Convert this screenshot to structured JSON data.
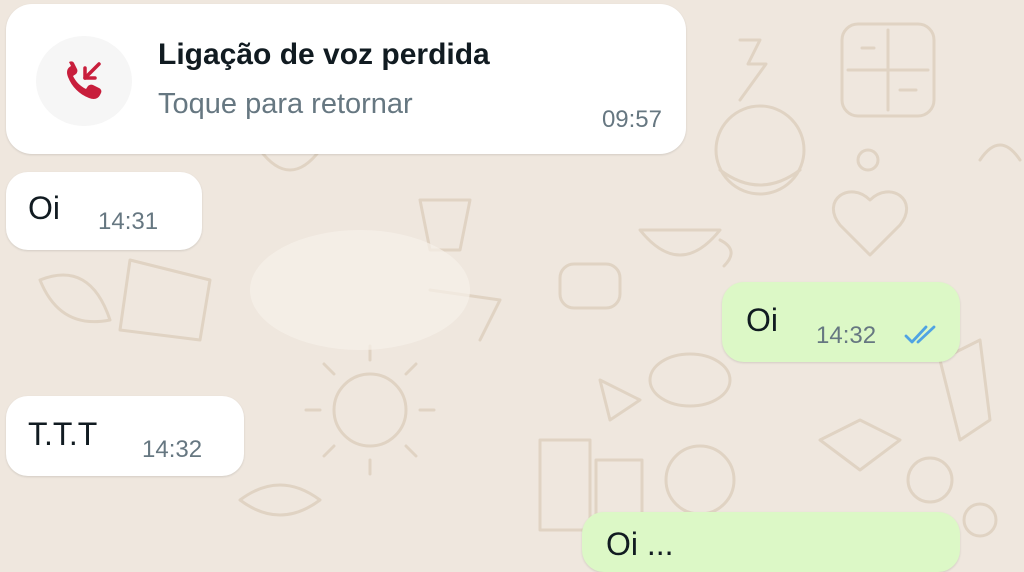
{
  "missed_call": {
    "title": "Ligação de voz perdida",
    "subtitle": "Toque para retornar",
    "time": "09:57",
    "icon": "missed-call-icon",
    "icon_color": "#c81e3c"
  },
  "messages": [
    {
      "direction": "incoming",
      "text": "Oi",
      "time": "14:31"
    },
    {
      "direction": "outgoing",
      "text": "Oi",
      "time": "14:32",
      "status_icon": "double-check-read-icon",
      "status_color": "#4fa3e3"
    },
    {
      "direction": "incoming",
      "text": "T.T.T",
      "time": "14:32"
    },
    {
      "direction": "outgoing",
      "text": "Oi ..."
    }
  ],
  "colors": {
    "background": "#efe7de",
    "incoming_bubble": "#ffffff",
    "outgoing_bubble": "#dcf8c6",
    "doodle": "#e2d6c8"
  }
}
